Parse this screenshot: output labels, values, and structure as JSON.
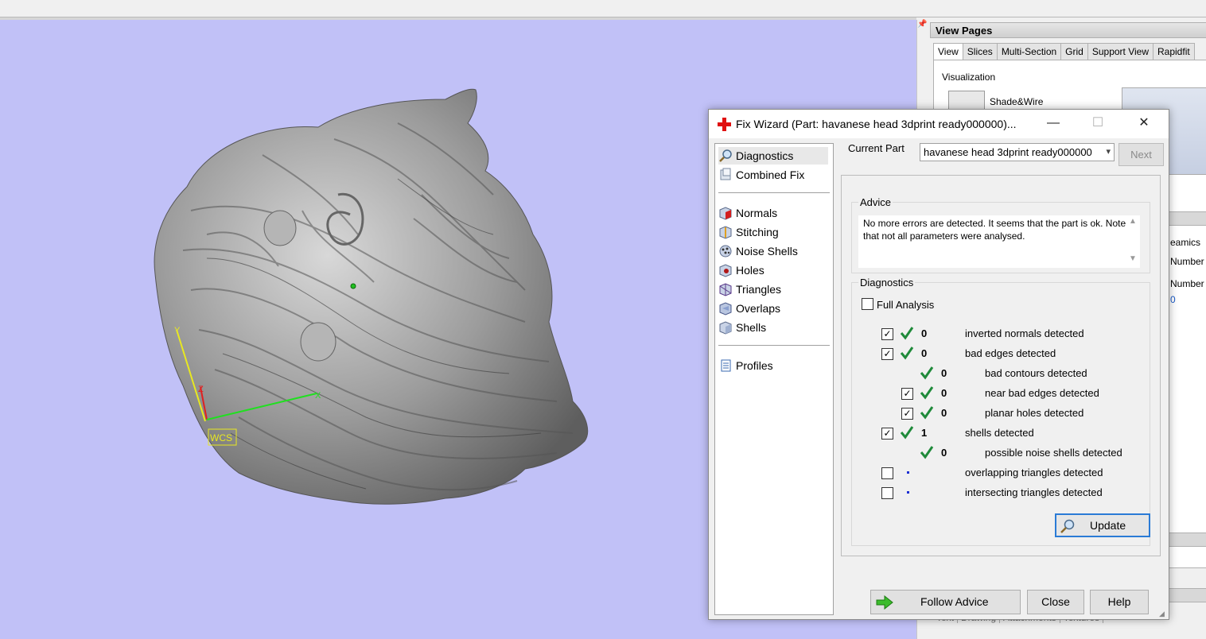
{
  "view_pages": {
    "title": "View Pages",
    "tabs": [
      "View",
      "Slices",
      "Multi-Section",
      "Grid",
      "Support View",
      "Rapidfit"
    ],
    "visualization_label": "Visualization",
    "shade_mode": "Shade&Wire",
    "fragments": [
      "eamics",
      "Number",
      "Number",
      "0"
    ],
    "bottom_tabs": [
      "Text",
      "Drawing",
      "Attachments",
      "Textures"
    ]
  },
  "viewport": {
    "wcs_label": "WCS",
    "axis_y_label": "Y",
    "axis_z_label": "Z",
    "axis_x_label": "X",
    "background_color": "#c1c1f7"
  },
  "dialog": {
    "title": "Fix Wizard (Part: havanese head 3dprint ready000000)...",
    "minimize_icon": "—",
    "maximize_icon": "☐",
    "close_icon": "✕",
    "nav": {
      "items_top": [
        {
          "label": "Diagnostics",
          "icon": "magnifier-icon"
        },
        {
          "label": "Combined Fix",
          "icon": "combined-fix-icon"
        }
      ],
      "items_mid": [
        {
          "label": "Normals",
          "icon": "normals-icon"
        },
        {
          "label": "Stitching",
          "icon": "stitching-icon"
        },
        {
          "label": "Noise Shells",
          "icon": "noise-shells-icon"
        },
        {
          "label": "Holes",
          "icon": "holes-icon"
        },
        {
          "label": "Triangles",
          "icon": "triangles-icon"
        },
        {
          "label": "Overlaps",
          "icon": "overlaps-icon"
        },
        {
          "label": "Shells",
          "icon": "shells-icon"
        }
      ],
      "items_bottom": [
        {
          "label": "Profiles",
          "icon": "profiles-icon"
        }
      ]
    },
    "current_part_label": "Current Part",
    "current_part_value": "havanese head 3dprint ready000000",
    "next_label": "Next",
    "advice": {
      "title": "Advice",
      "text": "No more errors are detected. It seems that the part is ok. Note that not all parameters were analysed."
    },
    "diagnostics": {
      "title": "Diagnostics",
      "full_analysis_label": "Full Analysis",
      "rows": [
        {
          "checkbox": true,
          "status": "ok",
          "value": "0",
          "label": "inverted normals detected",
          "indent": 0
        },
        {
          "checkbox": true,
          "status": "ok",
          "value": "0",
          "label": "bad edges detected",
          "indent": 0
        },
        {
          "checkbox": null,
          "status": "ok",
          "value": "0",
          "label": "bad contours detected",
          "indent": 1
        },
        {
          "checkbox": true,
          "status": "ok",
          "value": "0",
          "label": "near bad edges detected",
          "indent": 1
        },
        {
          "checkbox": true,
          "status": "ok",
          "value": "0",
          "label": "planar holes detected",
          "indent": 1
        },
        {
          "checkbox": true,
          "status": "ok",
          "value": "1",
          "label": "shells detected",
          "indent": 0
        },
        {
          "checkbox": null,
          "status": "ok",
          "value": "0",
          "label": "possible noise shells detected",
          "indent": 1
        },
        {
          "checkbox": false,
          "status": "pending",
          "value": "",
          "label": "overlapping triangles detected",
          "indent": 0
        },
        {
          "checkbox": false,
          "status": "pending",
          "value": "",
          "label": "intersecting triangles detected",
          "indent": 0
        }
      ],
      "update_label": "Update"
    },
    "buttons": {
      "follow_advice": "Follow Advice",
      "close": "Close",
      "help": "Help"
    },
    "accent_color": "#2a7bd6",
    "check_color": "#1f8a3a"
  }
}
